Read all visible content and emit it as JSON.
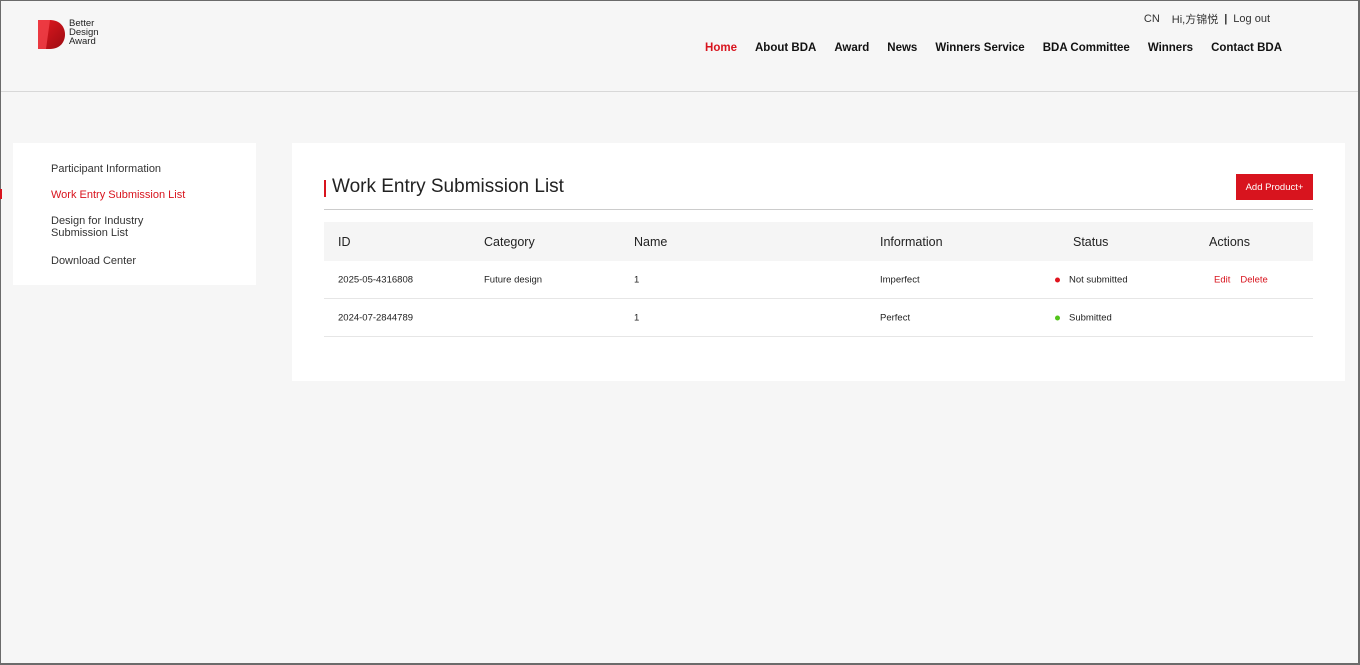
{
  "header": {
    "logo_lines": [
      "Better",
      "Design",
      "Award"
    ],
    "lang": "CN",
    "greeting": "Hi,方锦悦",
    "separator": "|",
    "logout": "Log out",
    "nav": [
      "Home",
      "About BDA",
      "Award",
      "News",
      "Winners Service",
      "BDA Committee",
      "Winners",
      "Contact BDA"
    ],
    "active_nav": "Home"
  },
  "sidebar": {
    "items": [
      {
        "label": "Participant Information"
      },
      {
        "label": "Work Entry Submission List"
      },
      {
        "label": "Design for Industry\nSubmission List"
      },
      {
        "label": "Download Center"
      }
    ],
    "active_index": 1
  },
  "main": {
    "title": "Work Entry Submission List",
    "add_button": "Add Product+",
    "columns": [
      "ID",
      "Category",
      "Name",
      "Information",
      "Status",
      "Actions"
    ],
    "rows": [
      {
        "id": "2025-05-4316808",
        "category": "Future design",
        "name": "1",
        "information": "Imperfect",
        "status": "Not submitted",
        "status_color": "#e0141e",
        "actions": [
          "Edit",
          "Delete"
        ]
      },
      {
        "id": "2024-07-2844789",
        "category": "",
        "name": "1",
        "information": "Perfect",
        "status": "Submitted",
        "status_color": "#52c41a",
        "actions": []
      }
    ]
  },
  "colors": {
    "accent": "#d8141e",
    "background": "#f6f6f6"
  }
}
